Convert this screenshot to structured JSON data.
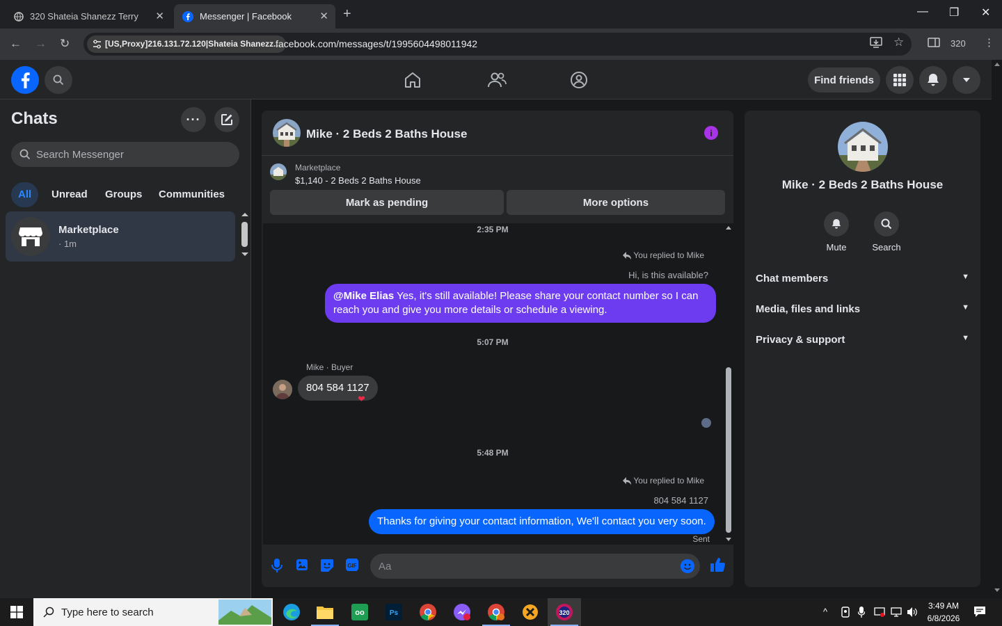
{
  "browser": {
    "tabs": [
      {
        "title": "320 Shateia Shanezz Terry",
        "active": false
      },
      {
        "title": "Messenger | Facebook",
        "active": true
      }
    ],
    "new_tab_label": "+",
    "site_info": "[US,Proxy]216.131.72.120|Shateia Shanezz...",
    "url": "facebook.com/messages/t/1995604498011942",
    "profile_label": "320"
  },
  "fb_header": {
    "find_friends_label": "Find friends",
    "colors": {
      "brand": "#0866ff",
      "surface": "#242526"
    }
  },
  "sidebar": {
    "title": "Chats",
    "search_placeholder": "Search Messenger",
    "filters": [
      "All",
      "Unread",
      "Groups",
      "Communities"
    ],
    "active_filter": "All",
    "chats": [
      {
        "name": "Marketplace",
        "time": "· 1m"
      }
    ]
  },
  "conversation": {
    "title": "Mike · 2 Beds 2 Baths House",
    "marketplace": {
      "category": "Marketplace",
      "listing": "$1,140 - 2 Beds 2 Baths House",
      "mark_pending_label": "Mark as pending",
      "more_options_label": "More options"
    },
    "messages": {
      "ts1": "2:35 PM",
      "reply1_label": "You replied to Mike",
      "reply1_quote": "Hi, is this available?",
      "out1_mention": "@Mike Elias",
      "out1_text": " Yes, it's still available! Please share your contact number so I can reach you and give you more details or schedule a viewing.",
      "ts2": "5:07 PM",
      "sender_label": "Mike · Buyer",
      "in1_text": "804 584 1127",
      "in1_reaction": "❤",
      "ts3": "5:48 PM",
      "reply2_label": "You replied to Mike",
      "reply2_quote": "804 584 1127",
      "out2_text": "Thanks for giving your contact information, We'll contact you very soon.",
      "status": "Sent"
    },
    "composer_placeholder": "Aa"
  },
  "info_panel": {
    "title": "Mike · 2 Beds 2 Baths House",
    "actions": [
      "Mute",
      "Search"
    ],
    "sections": [
      "Chat members",
      "Media, files and links",
      "Privacy & support"
    ]
  },
  "taskbar": {
    "search_placeholder": "Type here to search",
    "time": "3:49 AM",
    "date": "6/8/2026"
  }
}
